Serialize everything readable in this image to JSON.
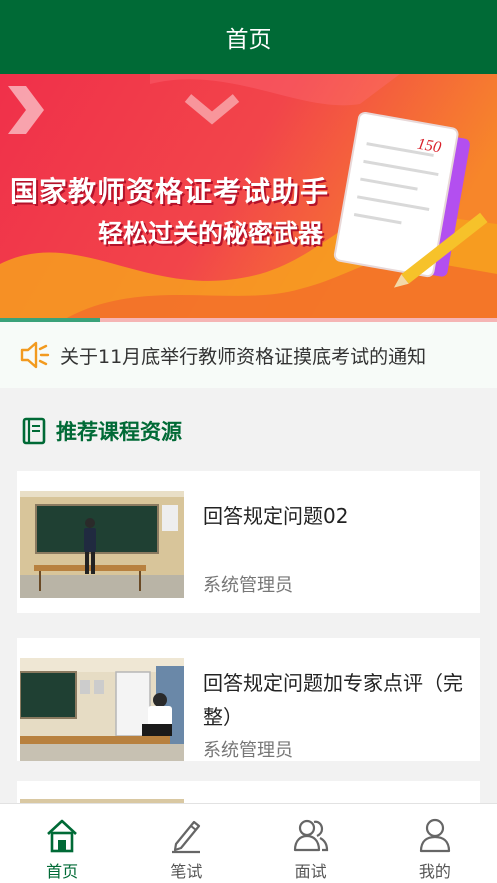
{
  "header": {
    "title": "首页"
  },
  "banner": {
    "line1": "国家教师资格证考试助手",
    "line2": "轻松过关的秘密武器",
    "score": "150",
    "page_index": 1,
    "page_count": 5
  },
  "notice": {
    "text": "关于11月底举行教师资格证摸底考试的通知",
    "icon": "speaker-icon"
  },
  "section": {
    "title": "推荐课程资源",
    "icon": "book-icon"
  },
  "courses": [
    {
      "title": "回答规定问题02",
      "author": "系统管理员"
    },
    {
      "title": "回答规定问题加专家点评（完整）",
      "author": "系统管理员"
    }
  ],
  "tabbar": {
    "items": [
      {
        "label": "首页",
        "icon": "home-icon",
        "active": true
      },
      {
        "label": "笔试",
        "icon": "pencil-icon",
        "active": false
      },
      {
        "label": "面试",
        "icon": "interview-icon",
        "active": false
      },
      {
        "label": "我的",
        "icon": "user-icon",
        "active": false
      }
    ]
  },
  "colors": {
    "brand": "#006a36",
    "banner_red": "#ee3048",
    "banner_orange": "#f47a2a"
  }
}
